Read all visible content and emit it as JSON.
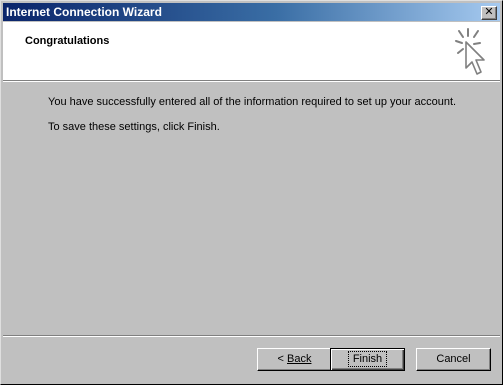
{
  "window": {
    "title": "Internet Connection Wizard",
    "close_glyph": "✕"
  },
  "header": {
    "title": "Congratulations",
    "icon": "wizard-cursor-sparkle-icon"
  },
  "body": {
    "line1": "You have successfully entered all of the information required to set up your account.",
    "line2": "To save these settings, click Finish."
  },
  "buttons": {
    "back_prefix": "< ",
    "back_label": "Back",
    "finish_label": "Finish",
    "cancel_label": "Cancel"
  },
  "colors": {
    "titlebar_start": "#0a246a",
    "titlebar_end": "#a6caf0",
    "face": "#c0c0c0",
    "header_bg": "#ffffff"
  }
}
